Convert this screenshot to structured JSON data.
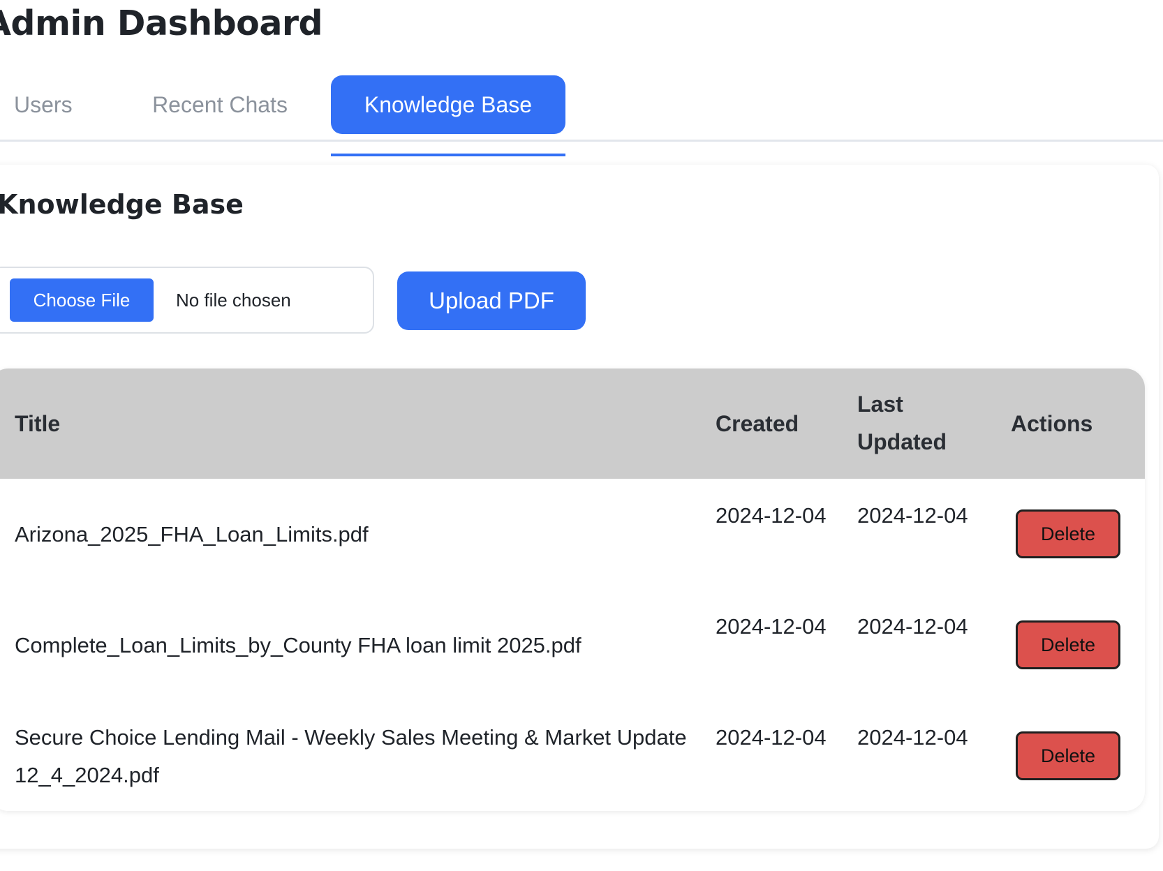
{
  "header": {
    "title": "Admin Dashboard"
  },
  "tabs": [
    {
      "label": "Users",
      "active": false
    },
    {
      "label": "Recent Chats",
      "active": false
    },
    {
      "label": "Knowledge Base",
      "active": true
    }
  ],
  "knowledge_base": {
    "title": "Knowledge Base",
    "upload": {
      "choose_file_label": "Choose File",
      "file_status": "No file chosen",
      "upload_button_label": "Upload PDF"
    },
    "table": {
      "columns": [
        "Title",
        "Created",
        "Last Updated",
        "Actions"
      ],
      "rows": [
        {
          "title": "Arizona_2025_FHA_Loan_Limits.pdf",
          "created": "2024-12-04",
          "last_updated": "2024-12-04",
          "action_label": "Delete"
        },
        {
          "title": "Complete_Loan_Limits_by_County FHA loan limit 2025.pdf",
          "created": "2024-12-04",
          "last_updated": "2024-12-04",
          "action_label": "Delete"
        },
        {
          "title": "Secure Choice Lending Mail - Weekly Sales Meeting & Market Update 12_4_2024.pdf",
          "created": "2024-12-04",
          "last_updated": "2024-12-04",
          "action_label": "Delete"
        }
      ]
    }
  },
  "colors": {
    "accent": "#3370f5",
    "delete": "#dc514d",
    "table_header_bg": "#cccccc",
    "text": "#1f2329",
    "muted_tab": "#8b929c"
  }
}
